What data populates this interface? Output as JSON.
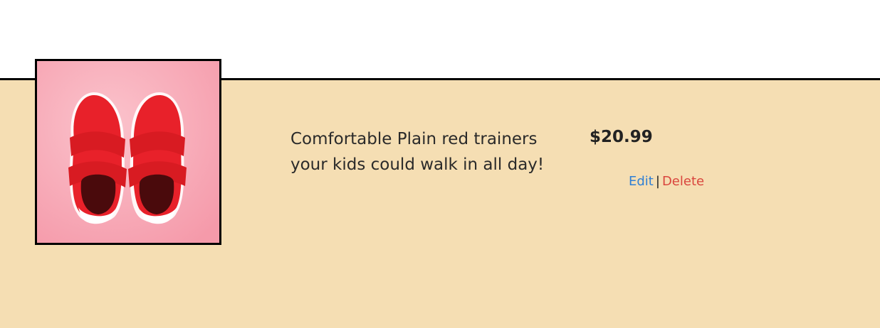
{
  "product": {
    "image_icon": "red-kids-trainers-photo",
    "description": "Comfortable Plain red trainers your kids could walk in all day!",
    "price": "$20.99",
    "actions": {
      "edit_label": "Edit",
      "separator": "|",
      "delete_label": "Delete"
    }
  },
  "colors": {
    "band_background": "#f5deb3",
    "edit_link": "#2f7fd4",
    "delete_link": "#d9453d"
  }
}
